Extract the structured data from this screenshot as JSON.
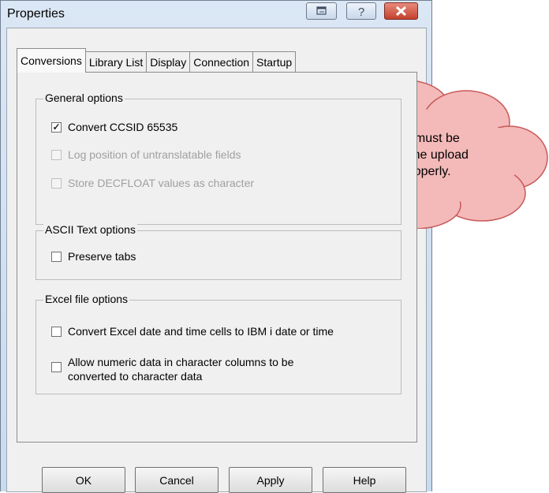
{
  "window": {
    "title": "Properties"
  },
  "title_buttons": {
    "restore": "restore",
    "help": "?",
    "close": "close"
  },
  "tabs": [
    {
      "label": "Conversions",
      "active": true
    },
    {
      "label": "Library List",
      "active": false
    },
    {
      "label": "Display",
      "active": false
    },
    {
      "label": "Connection",
      "active": false
    },
    {
      "label": "Startup",
      "active": false
    }
  ],
  "general_options": {
    "legend": "General options",
    "items": [
      {
        "label": "Convert CCSID 65535",
        "checked": true,
        "enabled": true
      },
      {
        "label": "Log position of untranslatable fields",
        "checked": false,
        "enabled": false
      },
      {
        "label": "Store DECFLOAT values as character",
        "checked": false,
        "enabled": false
      }
    ]
  },
  "ascii_options": {
    "legend": "ASCII Text options",
    "items": [
      {
        "label": "Preserve tabs",
        "checked": false,
        "enabled": true
      }
    ]
  },
  "excel_options": {
    "legend": "Excel file options",
    "items": [
      {
        "label": "Convert Excel date and time cells to IBM i date or time",
        "checked": false,
        "enabled": true
      },
      {
        "label": "Allow numeric data in character columns to be",
        "label2": "converted to character data",
        "checked": false,
        "enabled": true
      }
    ]
  },
  "buttons": {
    "ok": "OK",
    "cancel": "Cancel",
    "apply": "Apply",
    "help": "Help"
  },
  "callout": {
    "line1": "This option must be",
    "line2": "selected for the upload",
    "line3": "to work properly.",
    "fill": "#f4b9b9",
    "stroke": "#c85858"
  }
}
